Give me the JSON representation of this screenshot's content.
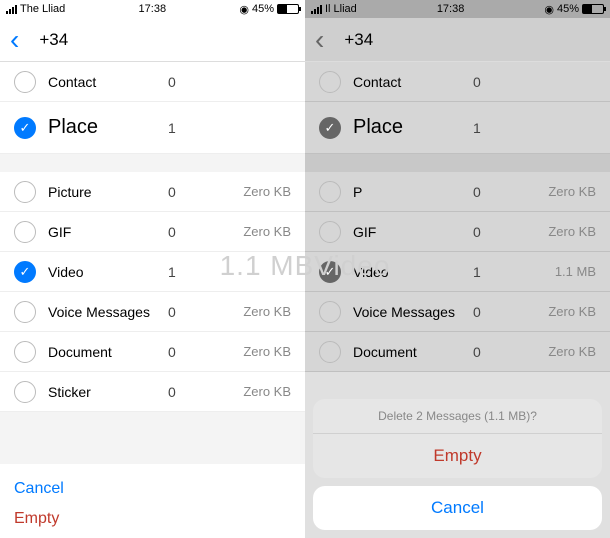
{
  "left": {
    "status": {
      "carrier": "The Lliad",
      "time": "17:38",
      "battery": "45%"
    },
    "nav_title": "+34",
    "section1": [
      {
        "label": "Contact",
        "count": "0",
        "checked": false
      },
      {
        "label": "Place",
        "count": "1",
        "checked": true
      }
    ],
    "section2": [
      {
        "label": "Picture",
        "count": "0",
        "size": "Zero KB",
        "checked": false
      },
      {
        "label": "GIF",
        "count": "0",
        "size": "Zero KB",
        "checked": false
      },
      {
        "label": "Video",
        "count": "1",
        "size": "",
        "checked": true
      },
      {
        "label": "Voice Messages",
        "count": "0",
        "size": "Zero KB",
        "checked": false
      },
      {
        "label": "Document",
        "count": "0",
        "size": "Zero KB",
        "checked": false
      },
      {
        "label": "Sticker",
        "count": "0",
        "size": "Zero KB",
        "checked": false
      }
    ],
    "cancel_label": "Cancel",
    "empty_label": "Empty"
  },
  "right": {
    "status": {
      "carrier": "Il Lliad",
      "time": "17:38",
      "battery": "45%"
    },
    "nav_title": "+34",
    "section1": [
      {
        "label": "Contact",
        "count": "0",
        "checked": false
      },
      {
        "label": "Place",
        "count": "1",
        "checked": true
      }
    ],
    "section2": [
      {
        "label": "P",
        "count": "0",
        "size": "Zero KB",
        "checked": false
      },
      {
        "label": "GIF",
        "count": "0",
        "size": "Zero KB",
        "checked": false
      },
      {
        "label": "Video",
        "count": "1",
        "size": "1.1 MB",
        "checked": true
      },
      {
        "label": "Voice Messages",
        "count": "0",
        "size": "Zero KB",
        "checked": false
      },
      {
        "label": "Document",
        "count": "0",
        "size": "Zero KB",
        "checked": false
      }
    ],
    "sheet": {
      "title": "Delete 2 Messages (1.1 MB)?",
      "empty": "Empty",
      "cancel": "Cancel"
    }
  },
  "overlay": "1.1 MBVideo"
}
